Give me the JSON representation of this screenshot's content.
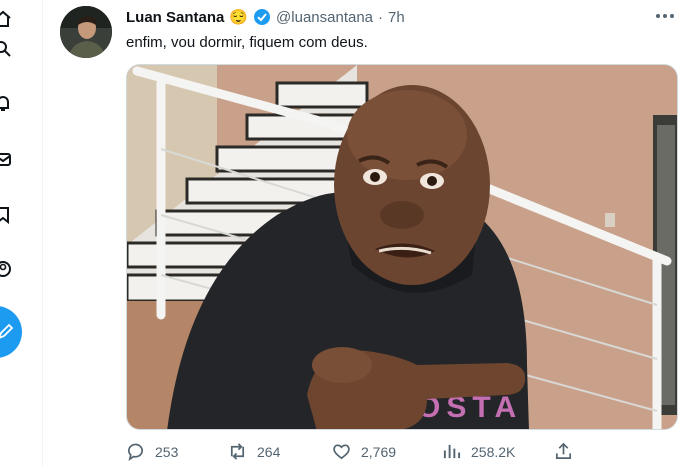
{
  "tweet": {
    "display_name": "Luan Santana",
    "name_emoji": "😌",
    "handle": "@luansantana",
    "separator": "·",
    "time": "7h",
    "text": "enfim, vou dormir, fiquem com deus."
  },
  "actions": {
    "replies": "253",
    "reposts": "264",
    "likes": "2,769",
    "views": "258.2K"
  },
  "media": {
    "hoodie_text": "OSTA"
  },
  "colors": {
    "accent": "#1d9bf0",
    "secondary_text": "#536471",
    "primary_text": "#0f1419"
  },
  "icons": [
    "home-icon",
    "search-icon",
    "notifications-icon",
    "messages-icon",
    "bookmark-icon",
    "profile-icon",
    "post-compose-icon",
    "more-options-icon",
    "verified-badge-icon",
    "reply-icon",
    "repost-icon",
    "like-icon",
    "views-icon",
    "share-icon"
  ]
}
